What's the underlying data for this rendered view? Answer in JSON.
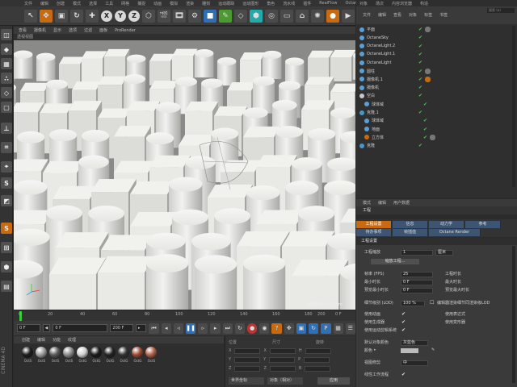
{
  "menubar": [
    "文件",
    "编辑",
    "创建",
    "模式",
    "选择",
    "工具",
    "网格",
    "捕捉",
    "动画",
    "模拟",
    "渲染",
    "雕刻",
    "运动跟踪",
    "运动图形",
    "角色",
    "流水线",
    "插件",
    "RealFlow",
    "Octane",
    "脚本",
    "窗口"
  ],
  "toolbar": {
    "x": "X",
    "y": "Y",
    "z": "Z"
  },
  "viewport": {
    "menu": [
      "查看",
      "摄像机",
      "显示",
      "选项",
      "过滤",
      "面板",
      "ProRender"
    ],
    "title": "透视视图",
    "grid_label": "网格间距：100 cm"
  },
  "timeline": {
    "ticks": [
      "0",
      "20",
      "40",
      "60",
      "80",
      "100",
      "120",
      "140",
      "160",
      "180",
      "200"
    ],
    "end_label": "0 F",
    "current_frame": "0 F",
    "start_field": "0 F",
    "end_field": "200 F",
    "end_field2": "200 F"
  },
  "material_manager": {
    "menu": [
      "创建",
      "编辑",
      "功能",
      "纹理"
    ],
    "materials": [
      {
        "label": "OctS",
        "color": "#1c1c1c"
      },
      {
        "label": "OctS",
        "color": "#9a9a9a"
      },
      {
        "label": "OctS",
        "color": "#5a5a5a"
      },
      {
        "label": "OctS",
        "color": "#8b8b8b"
      },
      {
        "label": "OctG",
        "color": "#d0d0d0"
      },
      {
        "label": "OctG",
        "color": "#1a1a1a"
      },
      {
        "label": "OctG",
        "color": "#222"
      },
      {
        "label": "OctG",
        "color": "#333"
      },
      {
        "label": "OctG",
        "color": "#9a4a30"
      },
      {
        "label": "OctS",
        "color": "#b06048"
      }
    ],
    "brand": "CINEMA 4D"
  },
  "coordinates": {
    "rows": [
      [
        "位置",
        "尺寸",
        "旋转"
      ],
      [
        "X",
        "X",
        "H"
      ],
      [
        "Y",
        "Y",
        "P"
      ],
      [
        "Z",
        "Z",
        "B"
      ]
    ],
    "world": "世界坐标",
    "scale": "对象（相对）",
    "apply": "应用"
  },
  "object_manager": {
    "tabs": [
      "对象",
      "场次",
      "内容浏览器",
      "构造"
    ],
    "menu": [
      "文件",
      "编辑",
      "查看",
      "对象",
      "标签",
      "书签"
    ],
    "search": "搜索 (o)",
    "objects": [
      {
        "name": "平面",
        "icon": "#5aa0d8"
      },
      {
        "name": "OctaneSky",
        "icon": "#5aa0d8"
      },
      {
        "name": "OctaneLight.2",
        "icon": "#5aa0d8"
      },
      {
        "name": "OctaneLight.1",
        "icon": "#5aa0d8"
      },
      {
        "name": "OctaneLight",
        "icon": "#5aa0d8"
      },
      {
        "name": "圆柱",
        "icon": "#5aa0d8"
      },
      {
        "name": "摄像机.1",
        "icon": "#5aa0d8"
      },
      {
        "name": "摄像机",
        "icon": "#5aa0d8"
      },
      {
        "name": "空白",
        "icon": "#c8c8c8"
      },
      {
        "name": "球体域",
        "icon": "#5aa0d8"
      },
      {
        "name": "克隆.1",
        "icon": "#49c"
      },
      {
        "name": "球体域",
        "icon": "#5aa0d8"
      },
      {
        "name": "地面",
        "icon": "#5aa0d8"
      },
      {
        "name": "立方体",
        "icon": "#c86a10"
      },
      {
        "name": "克隆",
        "icon": "#49c"
      }
    ]
  },
  "attribute_manager": {
    "menu": [
      "模式",
      "编辑",
      "用户数据"
    ],
    "head": "工程",
    "tabs": [
      "工程设置",
      "信息",
      "动力学",
      "参考",
      "待办事项",
      "帧插值",
      "Octane Render"
    ],
    "section": "工程设置",
    "props": {
      "scale_label": "工程缩放",
      "scale_value": "1",
      "scale_unit": "厘米",
      "scale_btn": "缩放工程...",
      "fps_label": "帧率 (FPS)",
      "fps_value": "25",
      "project_time_label": "工程时长",
      "min_time_label": "最小时长",
      "min_time_value": "0 F",
      "max_time_label": "最大时长",
      "preview_min_label": "预览最小时长",
      "preview_min_value": "0 F",
      "preview_max_label": "预览最大时长",
      "lod_label": "细节级别 (LOD)",
      "lod_value": "100 %",
      "render_lod_label": "编辑器渲染细节同渲染级LOD",
      "use_anim_label": "使用动画",
      "use_expr_label": "使用表达式",
      "use_gen_label": "使用生成器",
      "use_deform_label": "使用变形器",
      "use_motion_label": "使用运动剪辑系统",
      "default_color_label": "默认对象颜色",
      "default_color_value": "灰蓝色",
      "color_label": "颜色",
      "view_clip_label": "视图修剪",
      "view_clip_value": "中",
      "linear_label": "线性工作流程"
    }
  }
}
